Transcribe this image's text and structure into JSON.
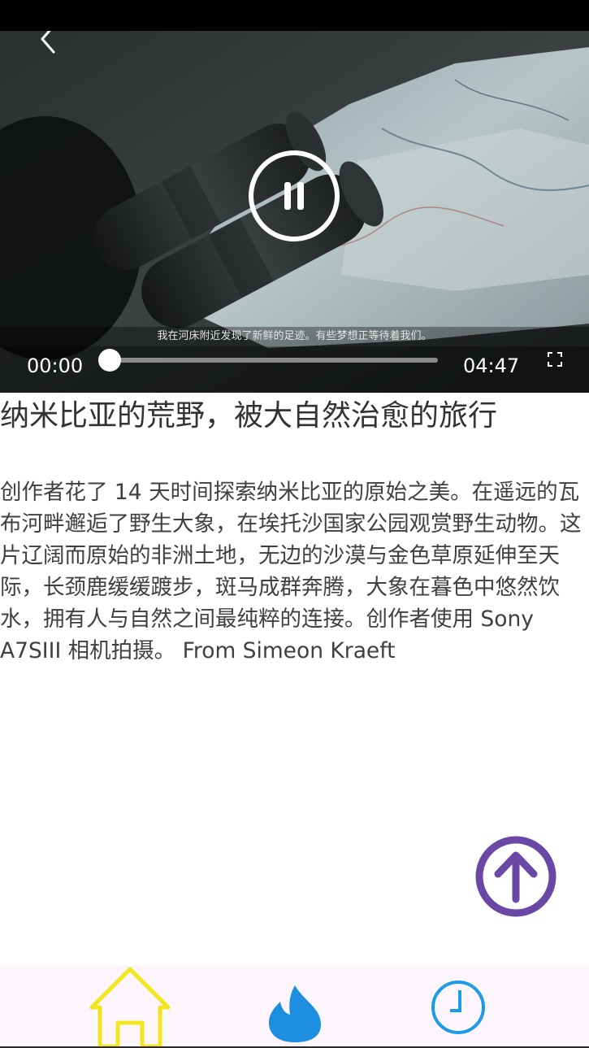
{
  "player": {
    "subtitle": "我在河床附近发现了新鲜的足迹。有些梦想正等待着我们。",
    "current_time": "00:00",
    "total_time": "04:47",
    "progress": 0,
    "state": "playing",
    "icons": {
      "back": "chevron-left-icon",
      "toggle": "pause-icon",
      "fullscreen": "fullscreen-icon"
    }
  },
  "article": {
    "title": "纳米比亚的荒野，被大自然治愈的旅行",
    "description": "创作者花了 14 天时间探索纳米比亚的原始之美。在遥远的瓦布河畔邂逅了野生大象，在埃托沙国家公园观赏野生动物。这片辽阔而原始的非洲土地，无边的沙漠与金色草原延伸至天际，长颈鹿缓缓踱步，斑马成群奔腾，大象在暮色中悠然饮水，拥有人与自然之间最纯粹的连接。创作者使用 Sony A7SIII 相机拍摄。 From Simeon Kraeft"
  },
  "scroll_top": {
    "icon": "arrow-up-circle-icon",
    "color": "#6b47a6"
  },
  "bottom_nav": {
    "items": [
      {
        "icon": "home-icon",
        "color": "#f2e51e"
      },
      {
        "icon": "flame-icon",
        "color": "#1e8ee0"
      },
      {
        "icon": "clock-icon",
        "color": "#1e9be6"
      }
    ],
    "background": "#fcf6fc"
  }
}
